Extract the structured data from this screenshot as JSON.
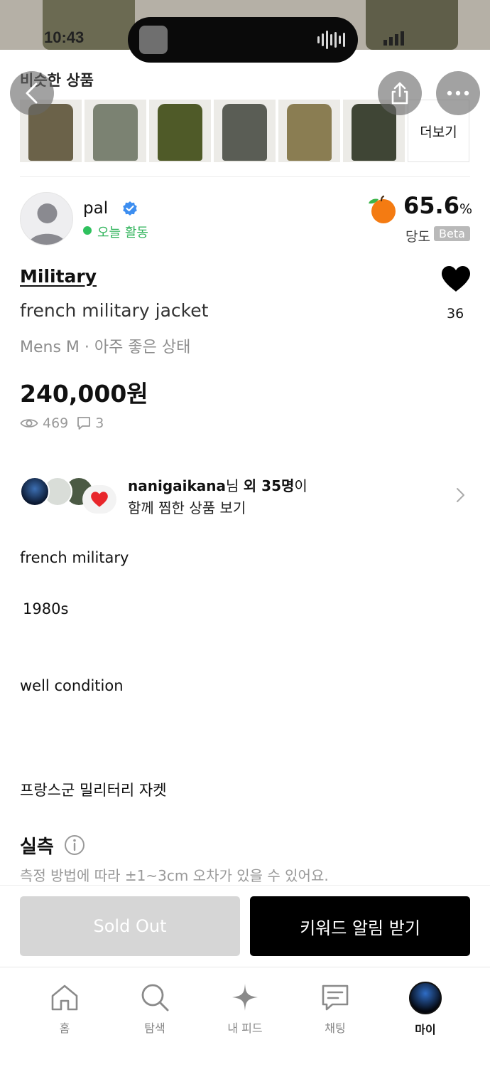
{
  "status_bar": {
    "time": "10:43"
  },
  "similar": {
    "title": "비슷한 상품",
    "more_label": "더보기",
    "thumb_colors": [
      "#6b6249",
      "#7b8272",
      "#4f5a28",
      "#5a5d55",
      "#8a7d52",
      "#3f4535"
    ]
  },
  "seller": {
    "name": "pal",
    "status": "오늘 활동",
    "sweetness_value": "65.6",
    "sweetness_unit": "%",
    "sweetness_label": "당도",
    "beta": "Beta"
  },
  "product": {
    "brand": "Military",
    "title": "french military jacket",
    "meta": "Mens M · 아주 좋은 상태",
    "price": "240,000원",
    "likes": "36",
    "views": "469",
    "comments": "3"
  },
  "liked_together": {
    "user": "nanigaikana",
    "suffix_1": "님 ",
    "suffix_2": "외 35명",
    "suffix_3": "이",
    "line2": "함께 찜한 상품 보기"
  },
  "description": {
    "lines": [
      "french military",
      "1980s",
      "well condition",
      "프랑스군 밀리터리 자켓"
    ]
  },
  "measurement": {
    "title": "실측",
    "note": "측정 방법에 따라 ±1~3cm 오차가 있을 수 있어요."
  },
  "actions": {
    "sold_out": "Sold Out",
    "keyword_alert": "키워드 알림 받기"
  },
  "tabs": [
    {
      "label": "홈",
      "icon": "home-icon"
    },
    {
      "label": "탐색",
      "icon": "search-icon"
    },
    {
      "label": "내 피드",
      "icon": "sparkle-icon"
    },
    {
      "label": "채팅",
      "icon": "chat-icon"
    },
    {
      "label": "마이",
      "icon": "my-avatar-icon"
    }
  ],
  "colors": {
    "active_green": "#2fc15e",
    "verified_blue": "#3d8ef0",
    "primary_black": "#000000",
    "disabled_gray": "#d6d6d6"
  }
}
